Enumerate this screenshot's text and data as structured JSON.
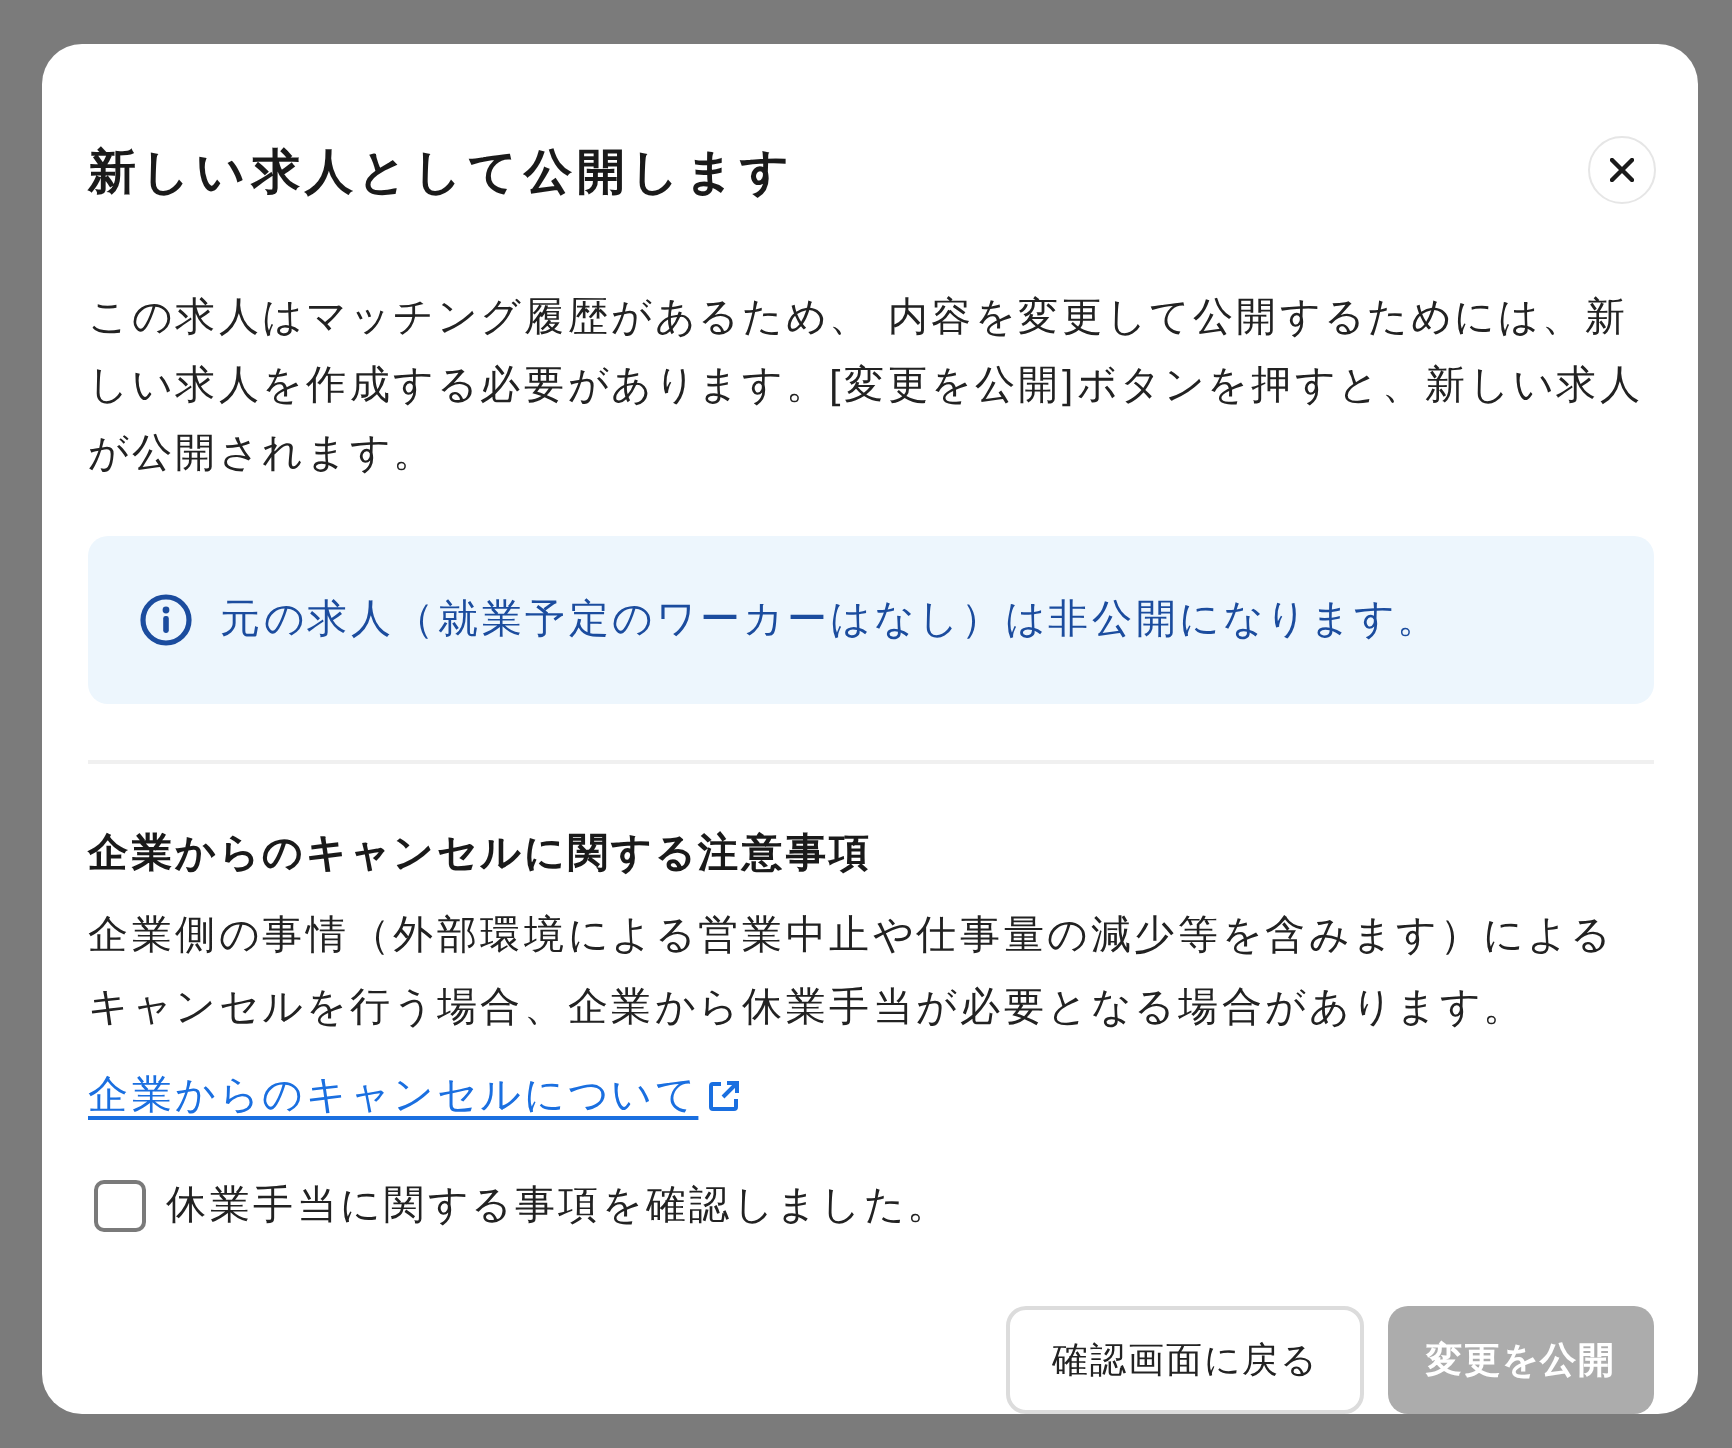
{
  "dialog": {
    "title": "新しい求人として公開します",
    "description": "この求人はマッチング履歴があるため、 内容を変更して公開するためには、新しい求人を作成する必要があります。[変更を公開]ボタンを押すと、新しい求人が公開されます。",
    "notice": {
      "kind": "info",
      "text": "元の求人（就業予定のワーカーはなし）は非公開になります。"
    },
    "section": {
      "heading": "企業からのキャンセルに関する注意事項",
      "body": "企業側の事情（外部環境による営業中止や仕事量の減少等を含みます）によるキャンセルを行う場合、企業から休業手当が必要となる場合があります。",
      "link": {
        "label": "企業からのキャンセルについて",
        "external": true
      }
    },
    "confirmation": {
      "label": "休業手当に関する事項を確認しました。",
      "checked": false
    },
    "buttons": [
      {
        "label": "確認画面に戻る",
        "kind": "secondary",
        "disabled": false
      },
      {
        "label": "変更を公開",
        "kind": "primary",
        "disabled": true
      }
    ]
  }
}
